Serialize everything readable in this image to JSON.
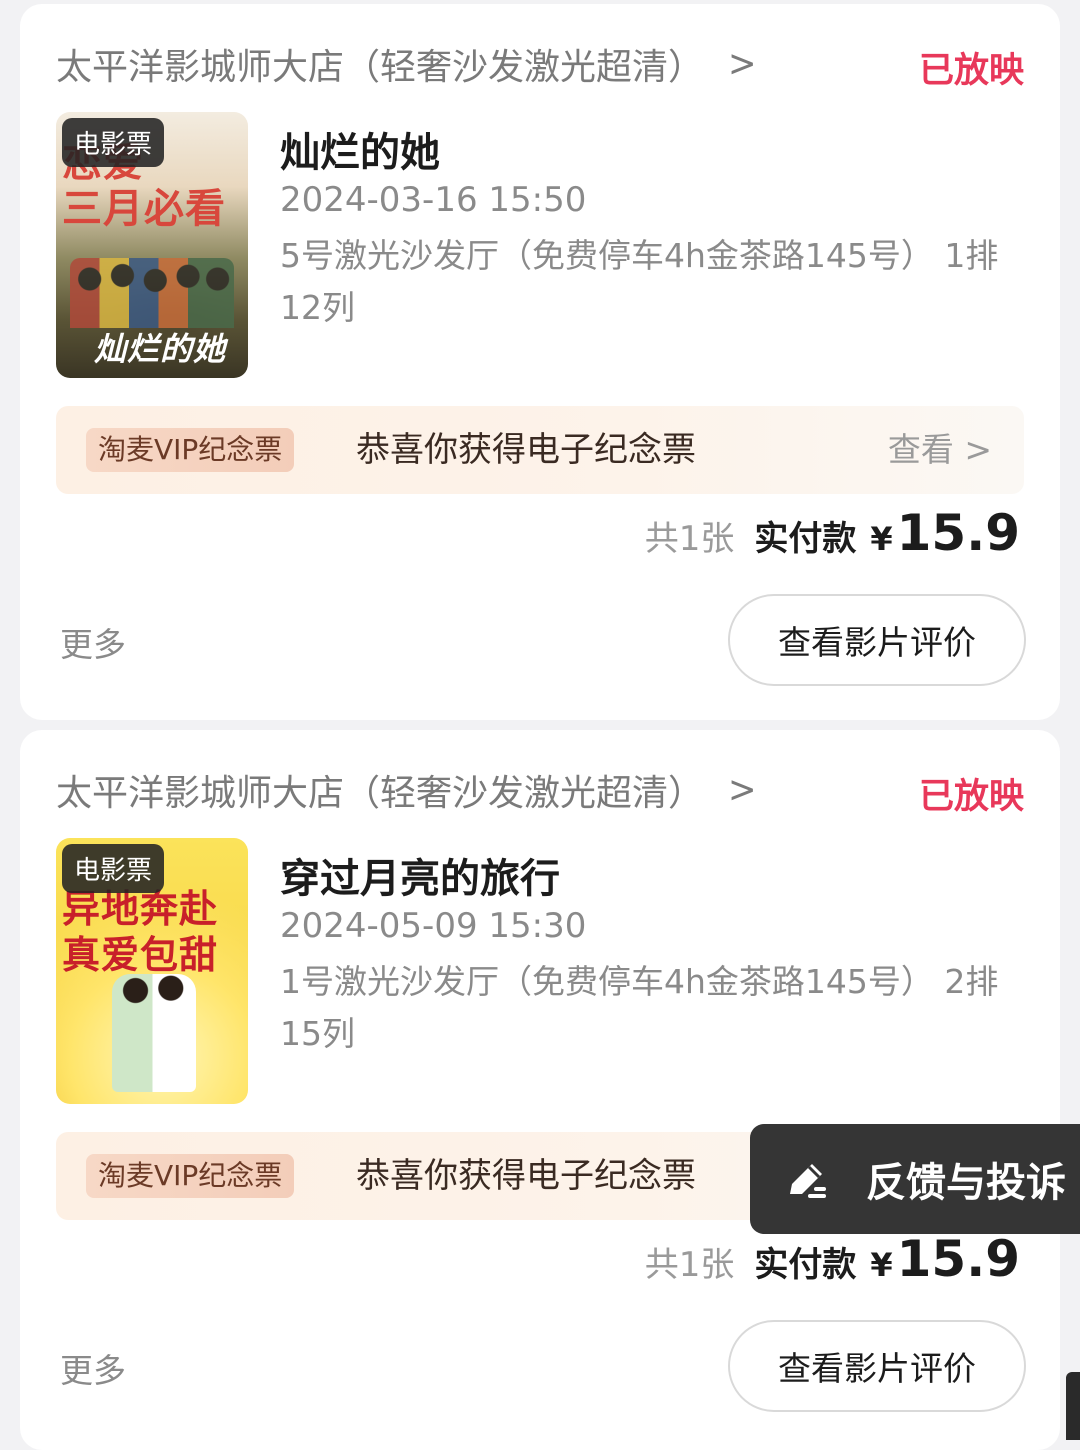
{
  "orders": [
    {
      "cinema": "太平洋影城师大店（轻奢沙发激光超清）",
      "status": "已放映",
      "poster_badge": "电影票",
      "poster_art_lines": [
        "恋爱",
        "三月必看",
        "灿烂的她"
      ],
      "title": "灿烂的她",
      "datetime": "2024-03-16 15:50",
      "hall": "5号激光沙发厅（免费停车4h金茶路145号） 1排12列",
      "memo_tag": "淘麦VIP纪念票",
      "memo_text": "恭喜你获得电子纪念票",
      "memo_view": "查看",
      "count": "共1张",
      "paid_label": "实付款",
      "currency": "¥",
      "amount": "15.9",
      "more": "更多",
      "review_button": "查看影片评价"
    },
    {
      "cinema": "太平洋影城师大店（轻奢沙发激光超清）",
      "status": "已放映",
      "poster_badge": "电影票",
      "poster_art_lines": [
        "异地奔赴",
        "真爱包甜"
      ],
      "title": "穿过月亮的旅行",
      "datetime": "2024-05-09 15:30",
      "hall": "1号激光沙发厅（免费停车4h金茶路145号） 2排15列",
      "memo_tag": "淘麦VIP纪念票",
      "memo_text": "恭喜你获得电子纪念票",
      "count": "共1张",
      "paid_label": "实付款",
      "currency": "¥",
      "amount": "15.9",
      "more": "更多",
      "review_button": "查看影片评价"
    }
  ],
  "feedback": {
    "label": "反馈与投诉",
    "icon": "edit-icon"
  },
  "colors": {
    "status_red": "#e8385a",
    "feedback_bg": "#353535",
    "page_bg": "#f2f2f4"
  }
}
